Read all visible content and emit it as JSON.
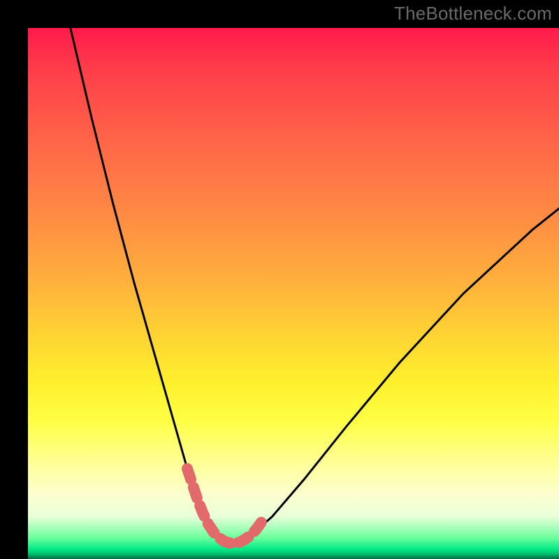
{
  "watermark": "TheBottleneck.com",
  "chart_data": {
    "type": "line",
    "title": "",
    "xlabel": "",
    "ylabel": "",
    "xlim": [
      0,
      100
    ],
    "ylim": [
      0,
      100
    ],
    "series": [
      {
        "name": "main-curve",
        "x": [
          8,
          12,
          16,
          20,
          24,
          28,
          30,
          32,
          33,
          34,
          35,
          36,
          37,
          38,
          39,
          40,
          42,
          46,
          52,
          60,
          70,
          82,
          95,
          100
        ],
        "y": [
          100,
          83,
          67,
          52,
          38,
          24,
          17,
          11,
          8.5,
          6.5,
          5,
          4,
          3.3,
          3,
          3,
          3.2,
          4.5,
          8,
          15,
          25,
          37,
          50,
          62,
          66
        ]
      },
      {
        "name": "valley-highlight",
        "x": [
          30,
          32,
          33,
          34,
          35,
          36,
          37,
          38,
          39,
          40,
          41,
          42,
          43,
          44
        ],
        "y": [
          17,
          11,
          8.5,
          6.5,
          5,
          4,
          3.3,
          3,
          3,
          3.2,
          3.8,
          4.5,
          5.6,
          7
        ]
      }
    ],
    "gradient_stops": [
      {
        "pos": 0.0,
        "color": "#ff1a4b"
      },
      {
        "pos": 0.35,
        "color": "#ff8a44"
      },
      {
        "pos": 0.67,
        "color": "#fff02d"
      },
      {
        "pos": 0.92,
        "color": "#e9ffd9"
      },
      {
        "pos": 0.98,
        "color": "#00e985"
      },
      {
        "pos": 1.0,
        "color": "#006d40"
      }
    ]
  }
}
